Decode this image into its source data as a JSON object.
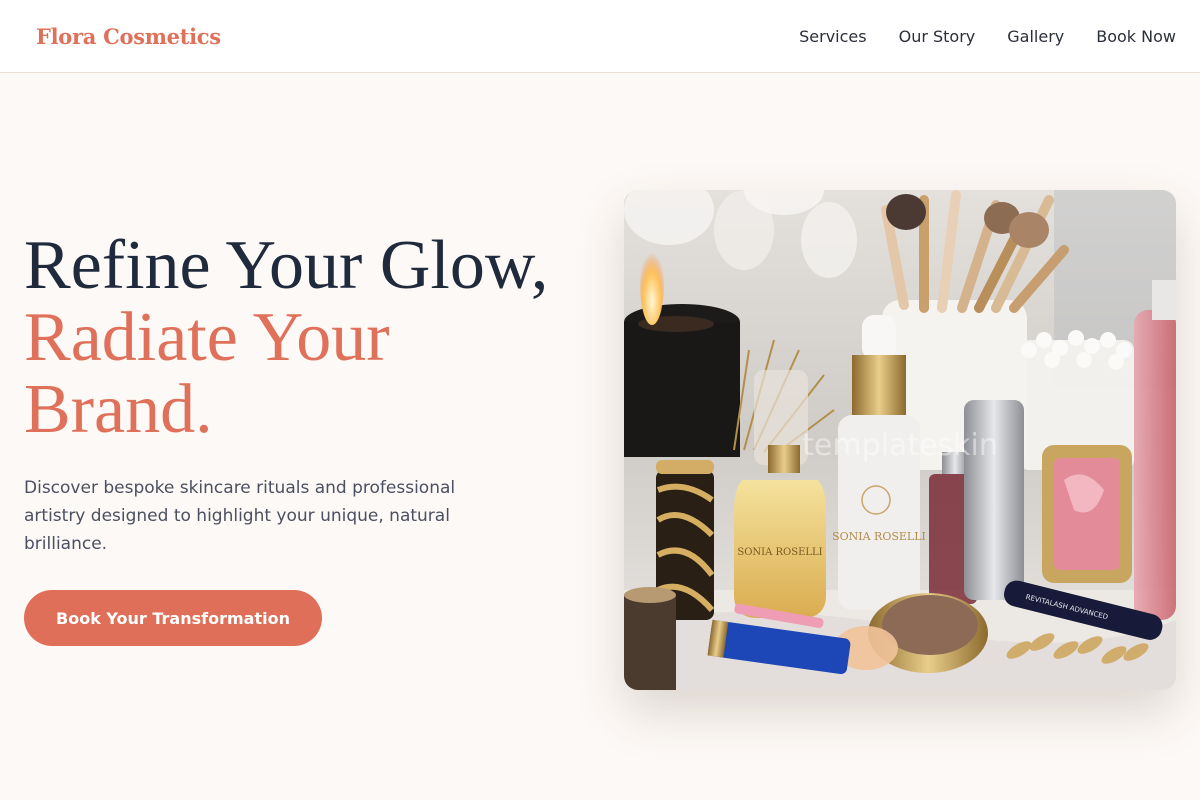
{
  "header": {
    "brand": "Flora Cosmetics",
    "nav": [
      "Services",
      "Our Story",
      "Gallery",
      "Book Now"
    ]
  },
  "hero": {
    "headline_line1": "Refine Your Glow,",
    "headline_accent": "Radiate Your Brand.",
    "subtitle": "Discover bespoke skincare rituals and professional artistry designed to highlight your unique, natural brilliance.",
    "cta_label": "Book Your Transformation",
    "image": {
      "watermark": "templateskin",
      "bottle_label_1": "SONIA ROSELLI",
      "bottle_label_2": "SONIA ROSELLI",
      "mascara_label": "REVITALASH ADVANCED"
    }
  },
  "colors": {
    "accent": "#df7059",
    "heading": "#1f2a3c",
    "background": "#fdf9f6"
  }
}
